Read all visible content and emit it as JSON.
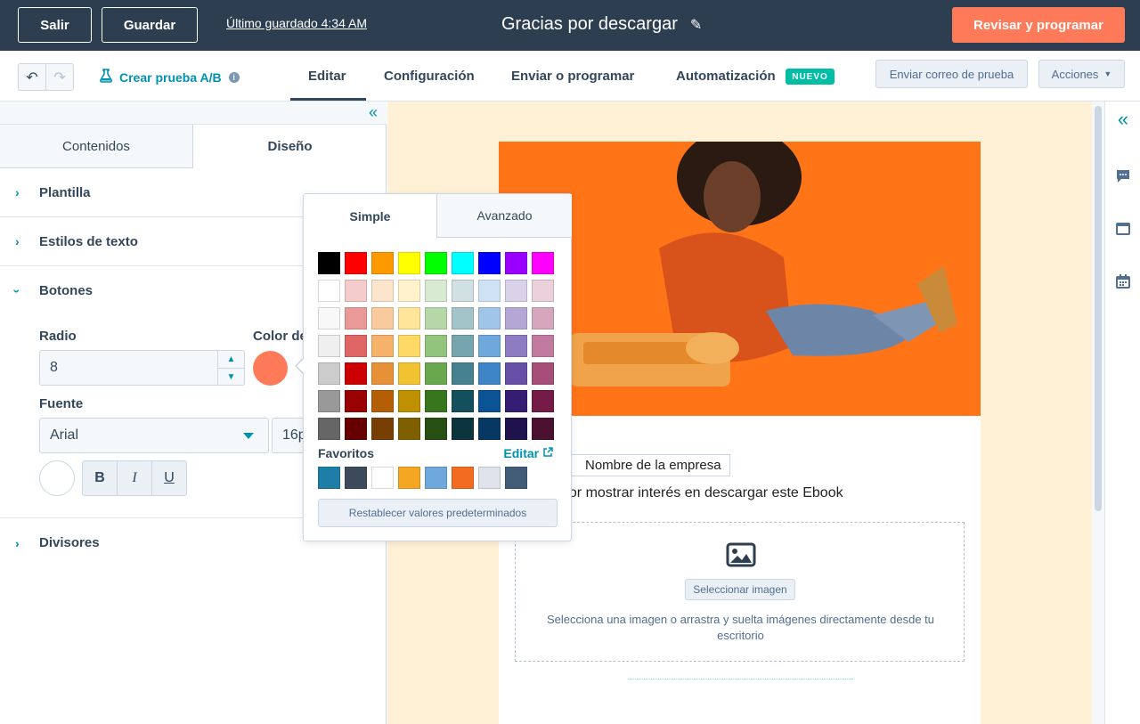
{
  "header": {
    "exit_label": "Salir",
    "save_label": "Guardar",
    "last_saved": "Último guardado 4:34 AM",
    "title": "Gracias por descargar",
    "review_label": "Revisar y programar"
  },
  "toolbar": {
    "ab_test_label": "Crear prueba A/B",
    "tabs": [
      "Editar",
      "Configuración",
      "Enviar o programar",
      "Automatización"
    ],
    "active_tab": "Editar",
    "new_badge": "NUEVO",
    "test_email_label": "Enviar correo de prueba",
    "actions_label": "Acciones"
  },
  "sidebar": {
    "tabs": [
      "Contenidos",
      "Diseño"
    ],
    "active_tab": "Diseño",
    "sections": [
      "Plantilla",
      "Estilos de texto",
      "Botones",
      "Divisores"
    ],
    "expanded_section": "Botones",
    "radius_label": "Radio",
    "radius_value": "8",
    "color_label": "Color de",
    "color_value": "#ff7a59",
    "font_label": "Fuente",
    "font_value": "Arial",
    "size_value": "16p",
    "format_buttons": [
      "B",
      "I",
      "U"
    ]
  },
  "color_picker": {
    "tabs": [
      "Simple",
      "Avanzado"
    ],
    "active_tab": "Simple",
    "palette": [
      [
        "#000000",
        "#ff0000",
        "#ff9900",
        "#ffff00",
        "#00ff00",
        "#00ffff",
        "#0000ff",
        "#9900ff",
        "#ff00ff"
      ],
      [
        "#ffffff",
        "#f4cccc",
        "#fce5cd",
        "#fff2cc",
        "#d9ead3",
        "#d0e0e3",
        "#cfe2f3",
        "#d9d2e9",
        "#ead1dc"
      ],
      [
        "#f8f8f8",
        "#ea9999",
        "#f9cb9c",
        "#ffe599",
        "#b6d7a8",
        "#a2c4c9",
        "#9fc5e8",
        "#b4a7d6",
        "#d5a6bd"
      ],
      [
        "#efefef",
        "#e06666",
        "#f6b26b",
        "#ffd966",
        "#93c47d",
        "#76a5af",
        "#6fa8dc",
        "#8e7cc3",
        "#c27ba0"
      ],
      [
        "#cccccc",
        "#cc0000",
        "#e69138",
        "#f1c232",
        "#6aa84f",
        "#45818e",
        "#3d85c6",
        "#674ea7",
        "#a64d79"
      ],
      [
        "#999999",
        "#990000",
        "#b45f06",
        "#bf9000",
        "#38761d",
        "#134f5c",
        "#0b5394",
        "#351c75",
        "#741b47"
      ],
      [
        "#666666",
        "#660000",
        "#783f04",
        "#7f6000",
        "#274e13",
        "#0c343d",
        "#073763",
        "#20124d",
        "#4c1130"
      ]
    ],
    "favorites_label": "Favoritos",
    "edit_label": "Editar",
    "favorites": [
      "#1f7ea8",
      "#3d4a5b",
      "#ffffff",
      "#f5a623",
      "#6fa8dc",
      "#f26b21",
      "#dfe3eb",
      "#425b76"
    ],
    "reset_label": "Restablecer valores predeterminados"
  },
  "email": {
    "company_name": "Nombre de la empresa",
    "thanks_text": "por mostrar interés en descargar este Ebook",
    "select_image_label": "Seleccionar imagen",
    "image_help": "Selecciona una imagen o arrastra y suelta imágenes directamente desde tu escritorio"
  },
  "icons": [
    "undo-icon",
    "redo-icon",
    "flask-icon",
    "info-icon",
    "pencil-icon",
    "collapse-icon",
    "chevron-right-icon",
    "chevron-down-icon",
    "image-icon",
    "external-link-icon",
    "chat-icon",
    "window-icon",
    "calendar-icon"
  ],
  "colors": {
    "header_bg": "#2d3e50",
    "primary": "#ff7a59",
    "accent": "#0091ae",
    "badge": "#00bda5",
    "canvas_bg": "#fff1d6"
  }
}
